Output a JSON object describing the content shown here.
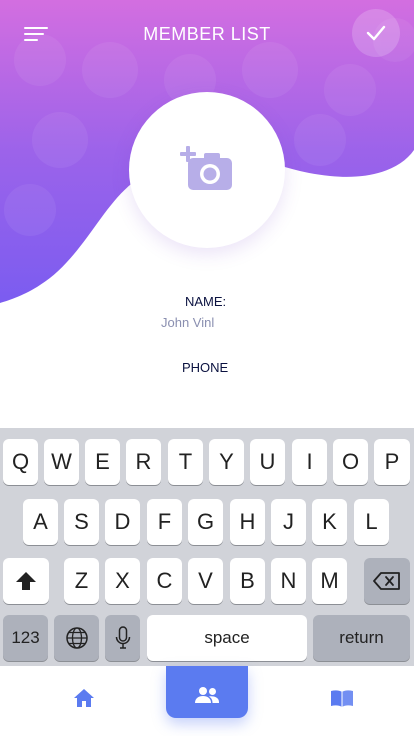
{
  "header": {
    "title": "MEMBER LIST",
    "menu_icon": "menu-icon",
    "confirm_icon": "check-icon"
  },
  "colors": {
    "gradient_top": "#c06ae0",
    "gradient_bottom": "#7f5bf0",
    "accent": "#5b7bf0",
    "text_dark": "#0b1240",
    "text_muted": "#8a8fb0"
  },
  "avatar": {
    "icon": "add-photo-icon"
  },
  "form": {
    "name_label": "NAME:",
    "name_value": "John Vinl",
    "phone_label": "PHONE"
  },
  "keyboard": {
    "row1": [
      "Q",
      "W",
      "E",
      "R",
      "T",
      "Y",
      "U",
      "I",
      "O",
      "P"
    ],
    "row2": [
      "A",
      "S",
      "D",
      "F",
      "G",
      "H",
      "J",
      "K",
      "L"
    ],
    "row3": [
      "Z",
      "X",
      "C",
      "V",
      "B",
      "N",
      "M"
    ],
    "numbers_key": "123",
    "space_key": "space",
    "return_key": "return",
    "shift_icon": "shift-icon",
    "delete_icon": "backspace-icon",
    "globe_icon": "globe-icon",
    "mic_icon": "microphone-icon"
  },
  "bottom_nav": {
    "items": [
      {
        "icon": "home-icon",
        "active": false
      },
      {
        "icon": "people-icon",
        "active": true
      },
      {
        "icon": "book-icon",
        "active": false
      }
    ]
  }
}
